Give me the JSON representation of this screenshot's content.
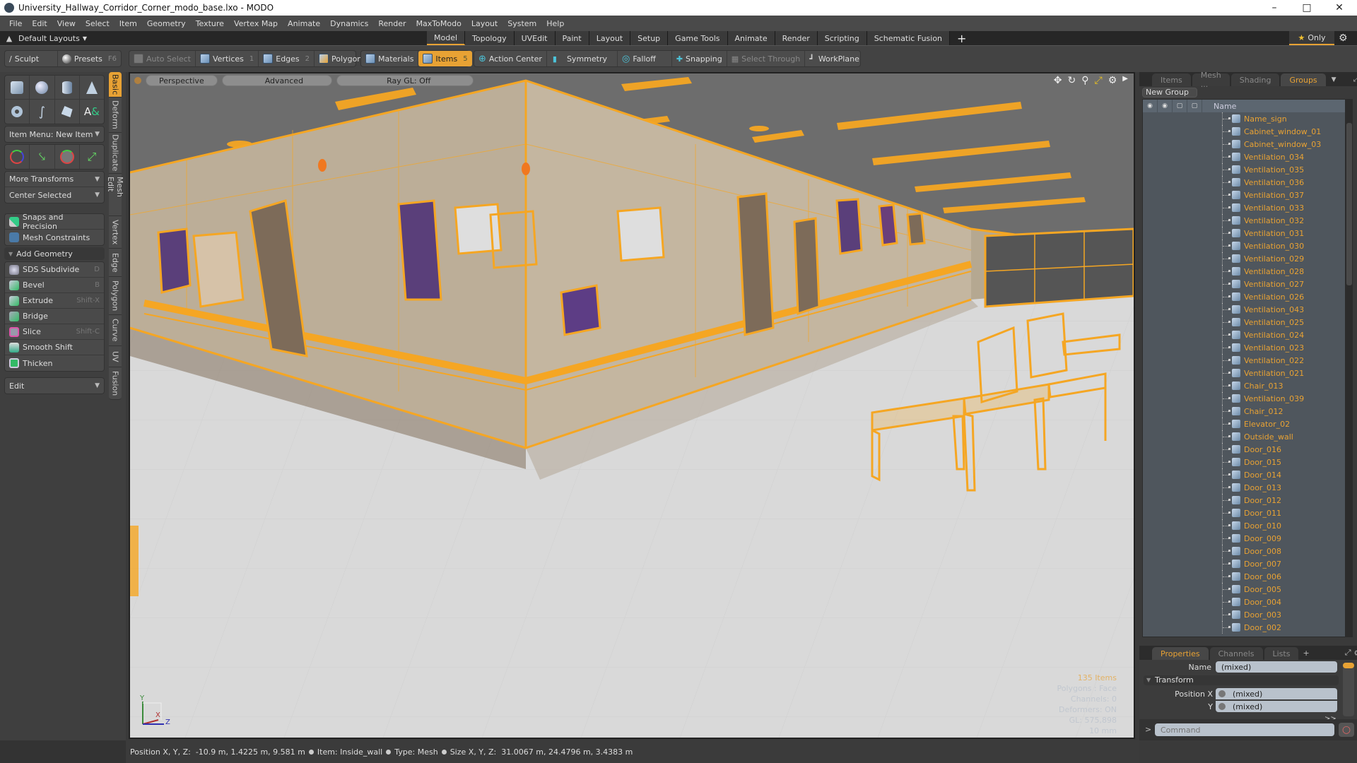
{
  "window": {
    "title": "University_Hallway_Corridor_Corner_modo_base.lxo - MODO",
    "controls": [
      "minimize",
      "maximize",
      "close"
    ]
  },
  "menu": [
    "File",
    "Edit",
    "View",
    "Select",
    "Item",
    "Geometry",
    "Texture",
    "Vertex Map",
    "Animate",
    "Dynamics",
    "Render",
    "MaxToModo",
    "Layout",
    "System",
    "Help"
  ],
  "layoutbar": {
    "layouts_label": "Default Layouts",
    "tabs": [
      "Model",
      "Topology",
      "UVEdit",
      "Paint",
      "Layout",
      "Setup",
      "Game Tools",
      "Animate",
      "Render",
      "Scripting",
      "Schematic Fusion"
    ],
    "active_tab": "Model",
    "add_label": "+",
    "only_label": "Only"
  },
  "toolbar": {
    "sculpt": "Sculpt",
    "presets": "Presets",
    "presets_key": "F6",
    "auto_select": "Auto Select",
    "vertices": "Vertices",
    "vertices_key": "1",
    "edges": "Edges",
    "edges_key": "2",
    "polygons": "Polygons",
    "materials": "Materials",
    "items": "Items",
    "items_key": "5",
    "action_center": "Action Center",
    "symmetry": "Symmetry",
    "falloff": "Falloff",
    "snapping": "Snapping",
    "select_through": "Select Through",
    "workplane": "WorkPlane"
  },
  "leftpanel": {
    "item_menu": "Item Menu: New Item",
    "more_transforms": "More Transforms",
    "center_selected": "Center Selected",
    "snaps": "Snaps and Precision",
    "mesh_constraints": "Mesh Constraints",
    "add_geometry": "Add Geometry",
    "tools": [
      {
        "label": "SDS Subdivide",
        "key": "D"
      },
      {
        "label": "Bevel",
        "key": "B"
      },
      {
        "label": "Extrude",
        "key": "Shift-X"
      },
      {
        "label": "Bridge",
        "key": ""
      },
      {
        "label": "Slice",
        "key": "Shift-C"
      },
      {
        "label": "Smooth Shift",
        "key": ""
      },
      {
        "label": "Thicken",
        "key": ""
      }
    ],
    "edit": "Edit",
    "vtabs": [
      "Basic",
      "Deform",
      "Duplicate",
      "Mesh Edit",
      "Vertex",
      "Edge",
      "Polygon",
      "Curve",
      "UV",
      "Fusion"
    ],
    "active_vtab": "Basic"
  },
  "viewport": {
    "view": "Perspective",
    "advanced": "Advanced",
    "raygl": "Ray GL: Off",
    "info": {
      "items": "135 Items",
      "polygons": "Polygons : Face",
      "channels": "Channels: 0",
      "deformers": "Deformers: ON",
      "gl": "GL: 575,898",
      "scale": "10 mm"
    },
    "axis": {
      "x": "X",
      "y": "Y",
      "z": "Z"
    }
  },
  "rightpanel": {
    "tabs": [
      "Items",
      "Mesh ...",
      "Shading",
      "Groups"
    ],
    "active_tab": "Groups",
    "new_group": "New Group",
    "name_header": "Name",
    "groups": [
      "Name_sign",
      "Cabinet_window_01",
      "Cabinet_window_03",
      "Ventilation_034",
      "Ventilation_035",
      "Ventilation_036",
      "Ventilation_037",
      "Ventilation_033",
      "Ventilation_032",
      "Ventilation_031",
      "Ventilation_030",
      "Ventilation_029",
      "Ventilation_028",
      "Ventilation_027",
      "Ventilation_026",
      "Ventilation_043",
      "Ventilation_025",
      "Ventilation_024",
      "Ventilation_023",
      "Ventilation_022",
      "Ventilation_021",
      "Chair_013",
      "Ventilation_039",
      "Chair_012",
      "Elevator_02",
      "Outside_wall",
      "Door_016",
      "Door_015",
      "Door_014",
      "Door_013",
      "Door_012",
      "Door_011",
      "Door_010",
      "Door_009",
      "Door_008",
      "Door_007",
      "Door_006",
      "Door_005",
      "Door_004",
      "Door_003",
      "Door_002"
    ],
    "props_tabs": [
      "Properties",
      "Channels",
      "Lists"
    ],
    "active_props_tab": "Properties",
    "name_label": "Name",
    "name_value": "(mixed)",
    "transform_label": "Transform",
    "position_x_label": "Position X",
    "position_x_value": "(mixed)",
    "y_label": "Y",
    "y_value": "(mixed)",
    "more_label": ">>",
    "command_placeholder": "Command",
    "command_prompt": ">"
  },
  "statusbar": {
    "position_label": "Position X, Y, Z:",
    "position_value": "-10.9 m, 1.4225 m, 9.581 m",
    "item_label": "Item:",
    "item_value": "Inside_wall",
    "type_label": "Type:",
    "type_value": "Mesh",
    "size_label": "Size X, Y, Z:",
    "size_value": "31.0067 m, 24.4796 m, 3.4383 m"
  },
  "colors": {
    "accent": "#e8a234",
    "wall": "#bcae98",
    "floor": "#d6d6d6",
    "ceiling": "#6e6e6e",
    "wire": "#f5a623"
  }
}
